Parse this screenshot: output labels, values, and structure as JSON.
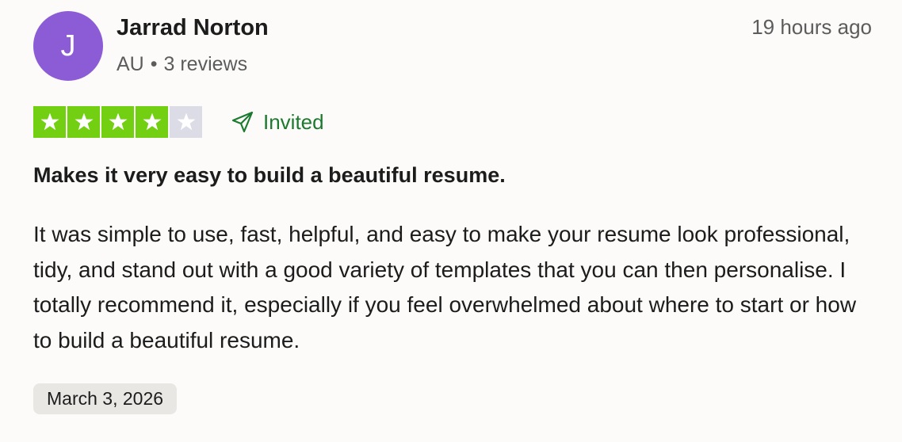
{
  "reviewer": {
    "initial": "J",
    "name": "Jarrad Norton",
    "country": "AU",
    "separator": "•",
    "review_count": "3 reviews",
    "avatar_color": "#8c5bd6"
  },
  "review": {
    "time_ago": "19 hours ago",
    "rating": 4,
    "max_rating": 5,
    "star_fill_color": "#73cf11",
    "star_empty_color": "#dcdce6",
    "invited_label": "Invited",
    "invited_color": "#1b7a2f",
    "invited_icon": "paper-plane-icon",
    "title": "Makes it very easy to build a beautiful resume.",
    "body": "It was simple to use, fast, helpful, and easy to make your resume look professional, tidy, and stand out with a good variety of templates that you can then personalise. I totally recommend it, especially if you feel overwhelmed about where to start or how to build a beautiful resume.",
    "date": "March 3, 2026"
  }
}
